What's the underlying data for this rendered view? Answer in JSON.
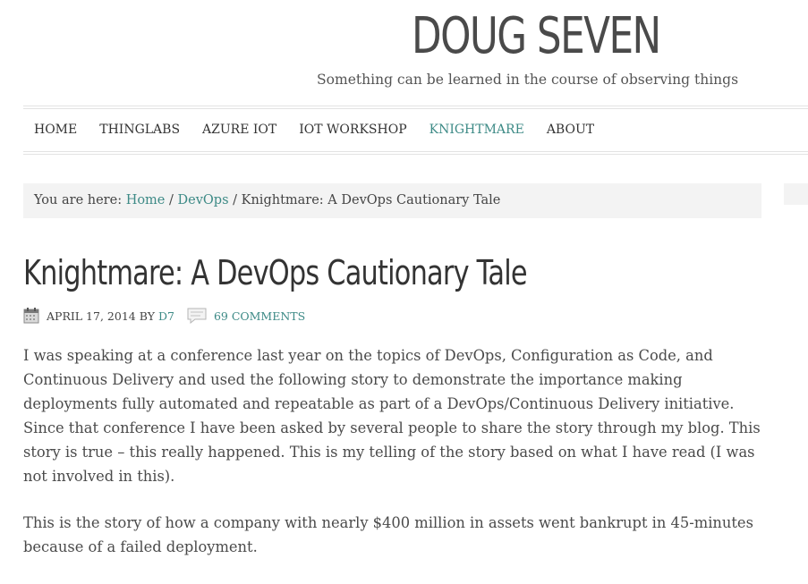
{
  "site": {
    "title": "DOUG SEVEN",
    "description": "Something can be learned in the course of observing things"
  },
  "nav": {
    "items": [
      {
        "label": "HOME"
      },
      {
        "label": "THINGLABS"
      },
      {
        "label": "AZURE IOT"
      },
      {
        "label": "IOT WORKSHOP"
      },
      {
        "label": "KNIGHTMARE"
      },
      {
        "label": "ABOUT"
      }
    ],
    "active_color": "#3d8a86"
  },
  "breadcrumb": {
    "prefix": "You are here:",
    "home": "Home",
    "sep": "/",
    "category": "DevOps",
    "current": "Knightmare: A DevOps Cautionary Tale"
  },
  "post": {
    "title": "Knightmare: A DevOps Cautionary Tale",
    "date": "APRIL 17, 2014",
    "by": "BY",
    "author": "D7",
    "comments": "69 COMMENTS",
    "paragraphs": [
      "I was speaking at a conference last year on the topics of DevOps, Configuration as Code, and Continuous Delivery and used the following story to demonstrate the importance making deployments fully automated and repeatable as part of a DevOps/Continuous Delivery initiative. Since that conference I have been asked by several people to share the story through my blog. This story is true – this really happened. This is my telling of the story based on what I have read (I was not involved in this).",
      "This is the story of how a company with nearly $400 million in assets went bankrupt in 45-minutes because of a failed deployment."
    ]
  },
  "icons": {
    "date": "calendar-icon",
    "comments": "comment-bubble-icon"
  },
  "colors": {
    "accent": "#3d8a86",
    "text": "#444444",
    "breadcrumb_bg": "#f3f3f3"
  }
}
